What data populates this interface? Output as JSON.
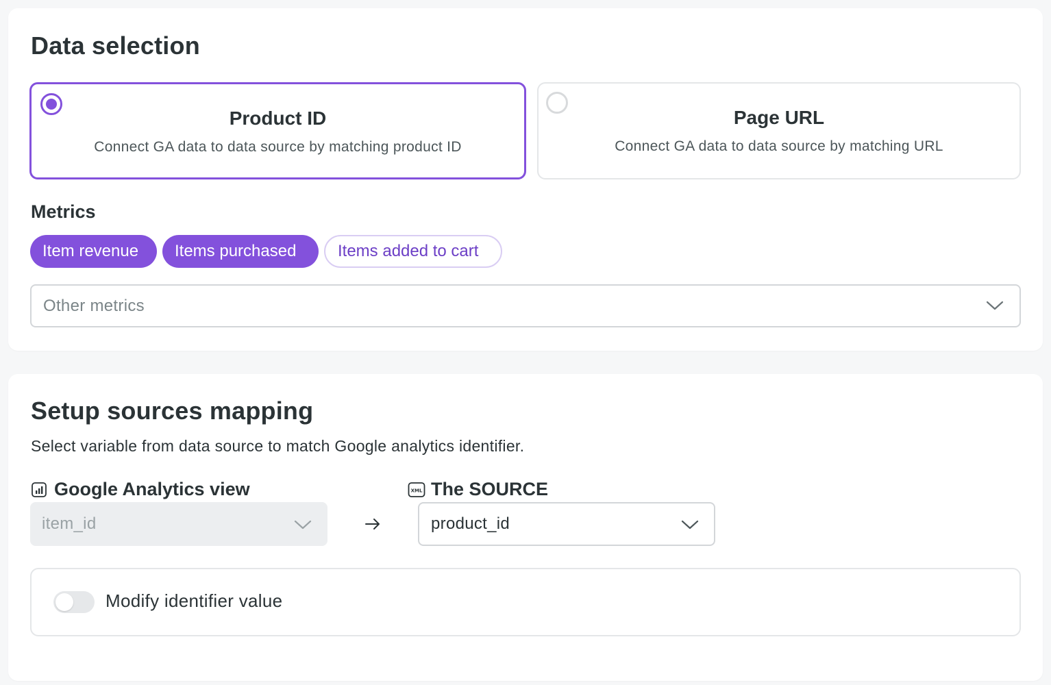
{
  "data_selection": {
    "title": "Data selection",
    "options": [
      {
        "title": "Product ID",
        "description": "Connect GA data to data source by matching product ID",
        "selected": true
      },
      {
        "title": "Page URL",
        "description": "Connect GA data to data source by matching URL",
        "selected": false
      }
    ],
    "metrics": {
      "title": "Metrics",
      "chips": [
        {
          "label": "Item revenue",
          "active": true
        },
        {
          "label": "Items purchased",
          "active": true
        },
        {
          "label": "Items added to cart",
          "active": false
        }
      ],
      "other_placeholder": "Other metrics"
    }
  },
  "mapping": {
    "title": "Setup sources mapping",
    "subtitle": "Select variable from data source to match Google analytics identifier.",
    "ga": {
      "label": "Google Analytics view",
      "icon": "analytics-chart-icon",
      "value": "item_id"
    },
    "source": {
      "label": "The SOURCE",
      "icon": "xml-file-icon",
      "value": "product_id"
    },
    "modify": {
      "label": "Modify identifier value",
      "enabled": false
    }
  },
  "colors": {
    "accent": "#8351dc",
    "text": "#2b3336"
  }
}
